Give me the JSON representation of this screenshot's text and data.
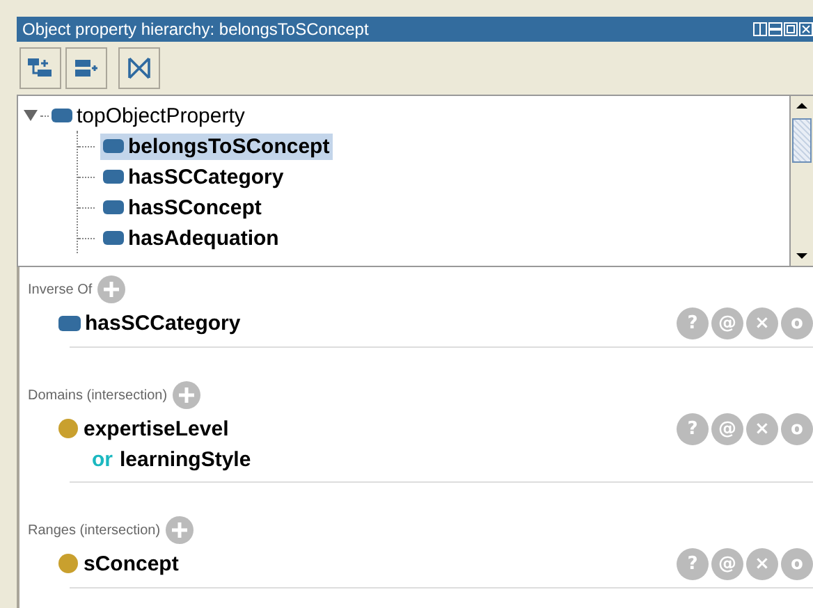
{
  "panel": {
    "title": "Object property hierarchy: belongsToSConcept"
  },
  "tree": [
    {
      "label": "topObjectProperty",
      "expanded": true,
      "selected": false,
      "children": [
        {
          "label": "belongsToSConcept",
          "selected": true
        },
        {
          "label": "hasSCCategory",
          "selected": false
        },
        {
          "label": "hasSConcept",
          "selected": false
        },
        {
          "label": "hasAdequation",
          "selected": false
        }
      ]
    }
  ],
  "sections": [
    {
      "title": "Inverse Of",
      "items": [
        {
          "kind": "property",
          "name": "hasSCCategory",
          "actions": [
            "?",
            "@",
            "×",
            "o"
          ]
        }
      ]
    },
    {
      "title": "Domains (intersection)",
      "items": [
        {
          "kind": "class",
          "name": "expertiseLevel",
          "union": [
            {
              "connective": "or",
              "name": "learningStyle"
            }
          ],
          "actions": [
            "?",
            "@",
            "×",
            "o"
          ]
        }
      ]
    },
    {
      "title": "Ranges (intersection)",
      "items": [
        {
          "kind": "class",
          "name": "sConcept",
          "actions": [
            "?",
            "@",
            "×",
            "o"
          ]
        }
      ]
    }
  ]
}
